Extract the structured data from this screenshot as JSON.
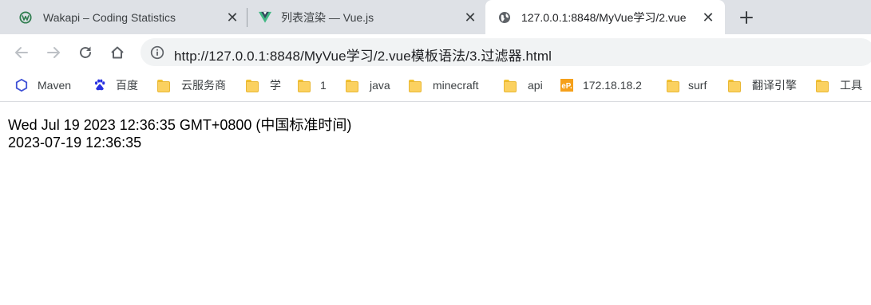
{
  "tabs": [
    {
      "title": "Wakapi – Coding Statistics",
      "icon": "wakapi-icon"
    },
    {
      "title": "列表渲染 — Vue.js",
      "icon": "vue-icon"
    },
    {
      "title": "127.0.0.1:8848/MyVue学习/2.vue",
      "icon": "globe-icon",
      "active": true
    }
  ],
  "toolbar": {
    "url": "http://127.0.0.1:8848/MyVue学习/2.vue模板语法/3.过滤器.html"
  },
  "bookmarks": [
    {
      "label": "Maven",
      "icon": "maven-icon"
    },
    {
      "label": "百度",
      "icon": "baidu-icon"
    },
    {
      "label": "云服务商",
      "icon": "folder-icon"
    },
    {
      "label": "学",
      "icon": "folder-icon"
    },
    {
      "label": "1",
      "icon": "folder-icon"
    },
    {
      "label": "java",
      "icon": "folder-icon"
    },
    {
      "label": "minecraft",
      "icon": "folder-icon"
    },
    {
      "label": "api",
      "icon": "folder-icon"
    },
    {
      "label": "172.18.18.2",
      "icon": "ep-icon"
    },
    {
      "label": "surf",
      "icon": "folder-icon"
    },
    {
      "label": "翻译引擎",
      "icon": "folder-icon"
    },
    {
      "label": "工具",
      "icon": "folder-icon"
    }
  ],
  "page": {
    "date_string": "Wed Jul 19 2023 12:36:35 GMT+0800 (中国标准时间)",
    "formatted_date": "2023-07-19 12:36:35"
  },
  "colors": {
    "tabstrip_bg": "#dee1e6",
    "active_tab_bg": "#ffffff",
    "omnibox_bg": "#f1f3f4",
    "accent": "#1a73e8",
    "vue_green": "#41b883",
    "vue_dark": "#35495e",
    "baidu_blue": "#2932e1",
    "maven_blue": "#3f51d6",
    "ep_orange": "#f5a01a"
  }
}
